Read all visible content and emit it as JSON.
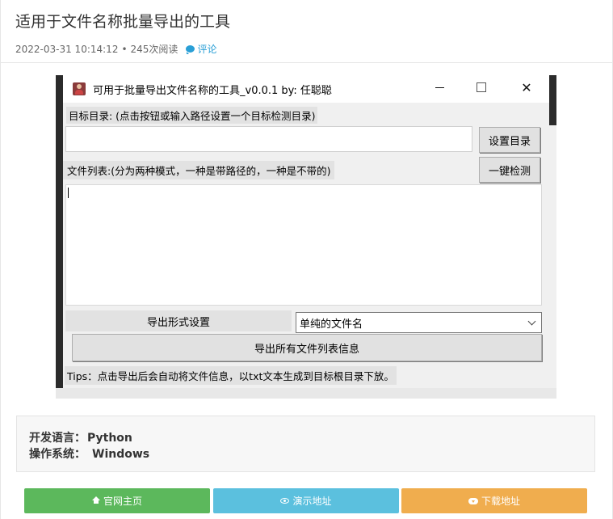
{
  "article": {
    "title": "适用于文件名称批量导出的工具",
    "date": "2022-03-31 10:14:12",
    "bullet": "•",
    "reads": "245次阅读",
    "comment_label": "评论"
  },
  "app_window": {
    "title": "可用于批量导出文件名称的工具_v0.0.1    by: 任聪聪",
    "close_glyph": "✕",
    "target_label": "目标目录: (点击按钮或输入路径设置一个目标检测目录)",
    "dir_input_value": "",
    "set_dir_button": "设置目录",
    "file_list_label": "文件列表:(分为两种模式，一种是带路径的，一种是不带的)",
    "detect_button": "一键检测",
    "export_format_label": "导出形式设置",
    "export_format_selected": "单纯的文件名",
    "export_all_button": "导出所有文件列表信息",
    "tips": "Tips：点击导出后会自动将文件信息，以txt文本生成到目标根目录下放。"
  },
  "info": {
    "lang_label": "开发语言：",
    "lang_value": "Python",
    "os_label": "操作系统：",
    "os_value": "Windows"
  },
  "buttons": {
    "home": "官网主页",
    "demo": "演示地址",
    "download": "下载地址"
  },
  "colors": {
    "accent_link": "#2a9fd6",
    "home_button": "#5cb85c",
    "demo_button": "#5bc0de",
    "download_button": "#f0ad4e"
  }
}
